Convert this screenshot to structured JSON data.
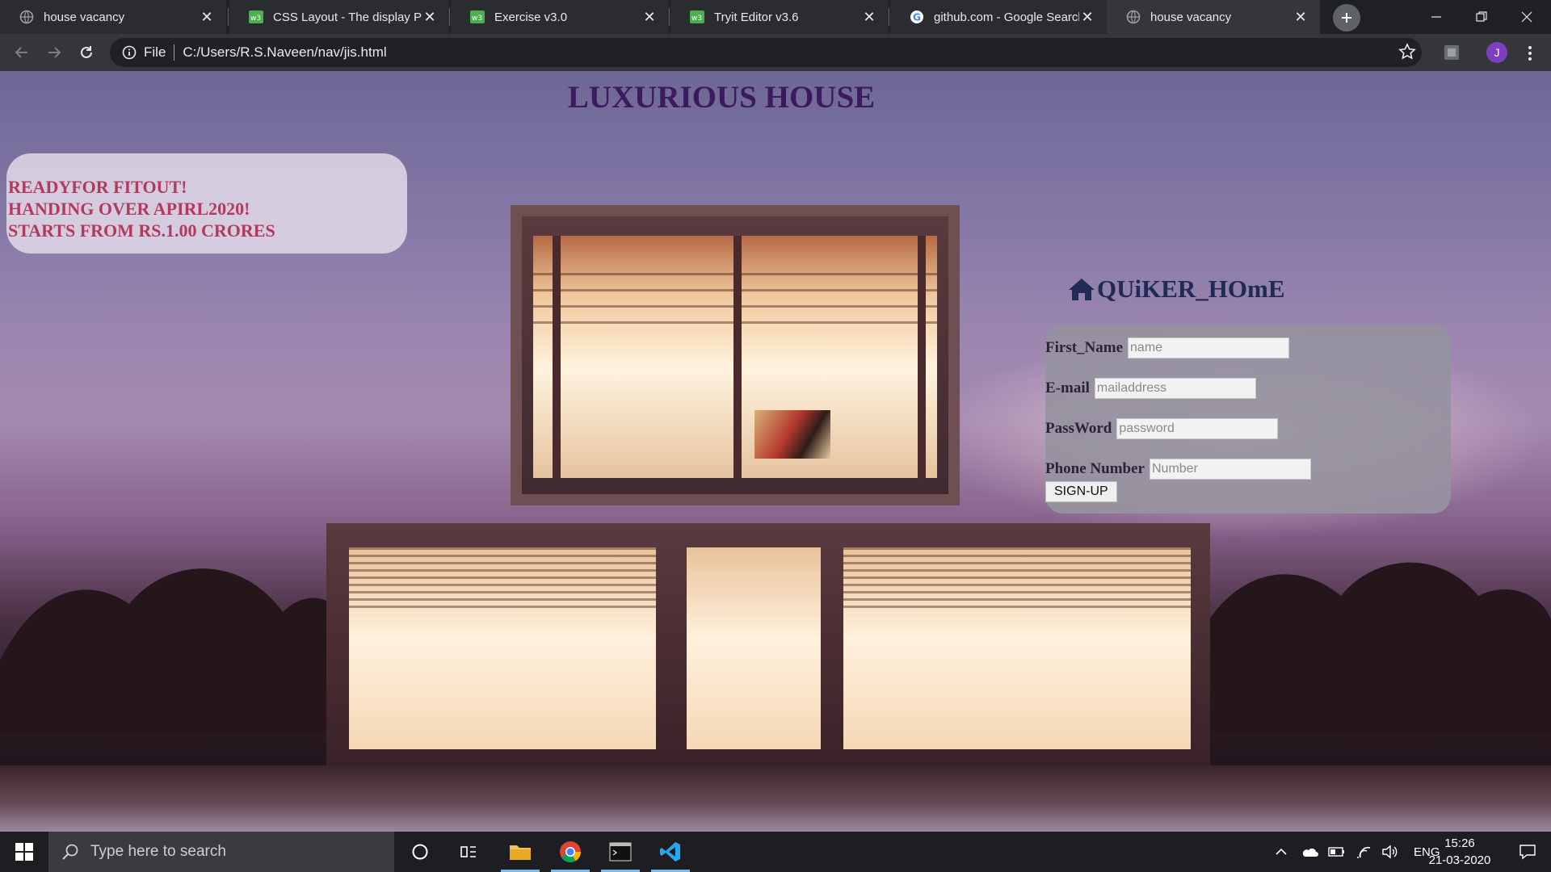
{
  "browser": {
    "tabs": [
      {
        "title": "house vacancy",
        "favicon": "globe-icon",
        "active": false
      },
      {
        "title": "CSS Layout - The display Property",
        "favicon": "w3schools-icon",
        "active": false
      },
      {
        "title": "Exercise v3.0",
        "favicon": "w3schools-icon",
        "active": false
      },
      {
        "title": "Tryit Editor v3.6",
        "favicon": "w3schools-icon",
        "active": false
      },
      {
        "title": "github.com - Google Search",
        "favicon": "google-icon",
        "active": false
      },
      {
        "title": "house vacancy",
        "favicon": "globe-icon",
        "active": true
      }
    ],
    "address": {
      "scheme": "File",
      "url": "C:/Users/R.S.Naveen/nav/jis.html"
    },
    "profile_initial": "J"
  },
  "page": {
    "title": "LUXURIOUS HOUSE",
    "promo": {
      "line1": "READYFOR FITOUT!",
      "line2": "HANDING OVER APIRL2020!",
      "line3": "STARTS FROM RS.1.00 CRORES"
    },
    "brand": "QUiKER_HOmE",
    "form": {
      "first_name": {
        "label": "First_Name",
        "placeholder": "name"
      },
      "email": {
        "label": "E-mail",
        "placeholder": "mailaddress"
      },
      "password": {
        "label": "PassWord",
        "placeholder": "password"
      },
      "phone": {
        "label": "Phone Number",
        "placeholder": "Number"
      },
      "submit": "SIGN-UP"
    }
  },
  "taskbar": {
    "search_placeholder": "Type here to search",
    "language": "ENG",
    "time": "15:26",
    "date": "21-03-2020"
  },
  "colors": {
    "title": "#3c1a5e",
    "promo_text": "#b23a5e",
    "brand": "#1f2a55",
    "chrome_bg": "#202124"
  }
}
